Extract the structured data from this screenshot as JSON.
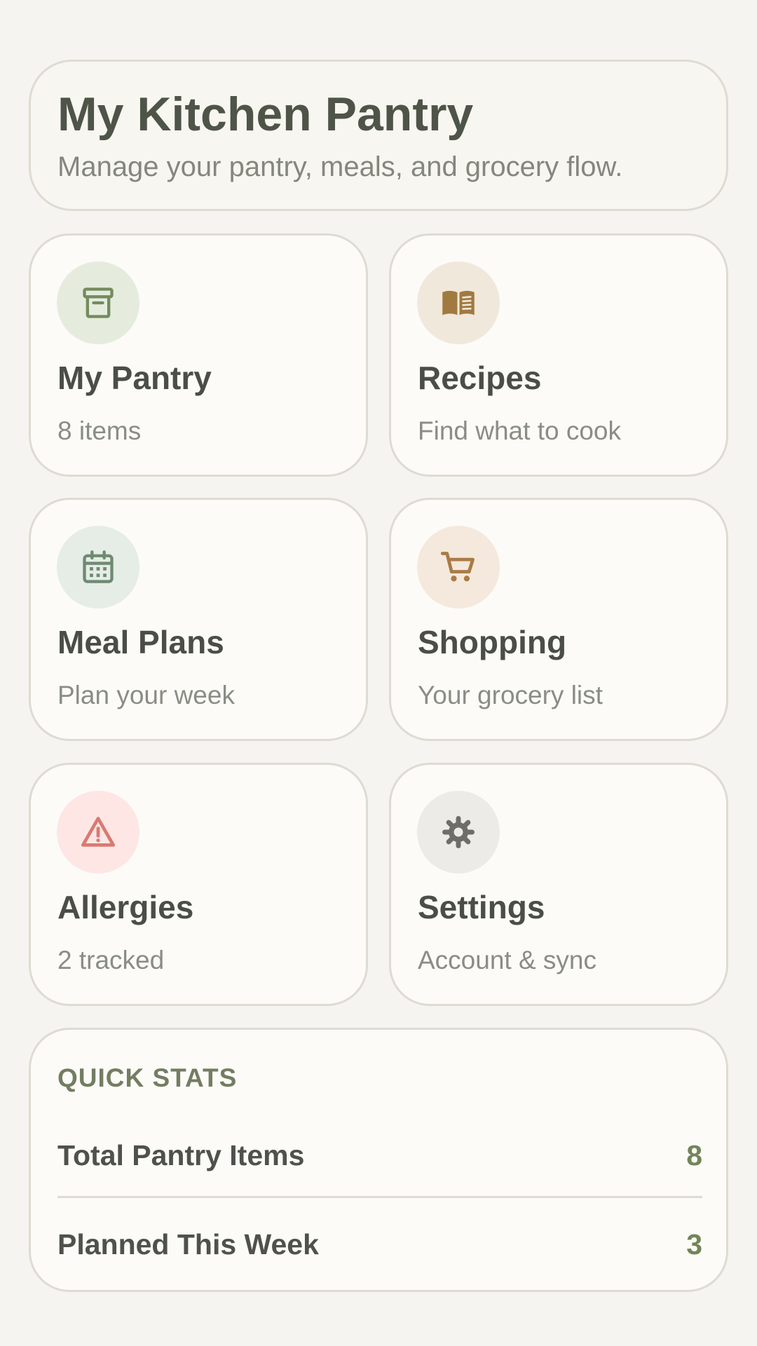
{
  "header": {
    "title": "My Kitchen Pantry",
    "subtitle": "Manage your pantry, meals, and grocery flow."
  },
  "cards": [
    {
      "title": "My Pantry",
      "subtitle": "8 items",
      "icon": "archive-box-icon",
      "icon_color": "#748b5e",
      "icon_bg": "#e5ecdd"
    },
    {
      "title": "Recipes",
      "subtitle": "Find what to cook",
      "icon": "open-book-icon",
      "icon_color": "#a17a3f",
      "icon_bg": "#f1e8dc"
    },
    {
      "title": "Meal Plans",
      "subtitle": "Plan your week",
      "icon": "calendar-icon",
      "icon_color": "#6f8a72",
      "icon_bg": "#e5ede6"
    },
    {
      "title": "Shopping",
      "subtitle": "Your grocery list",
      "icon": "shopping-cart-icon",
      "icon_color": "#a97b45",
      "icon_bg": "#f4e9dc"
    },
    {
      "title": "Allergies",
      "subtitle": "2 tracked",
      "icon": "warning-triangle-icon",
      "icon_color": "#d97a72",
      "icon_bg": "#fde6e4"
    },
    {
      "title": "Settings",
      "subtitle": "Account & sync",
      "icon": "gear-icon",
      "icon_color": "#6e6d69",
      "icon_bg": "#ecebe7"
    }
  ],
  "stats": {
    "heading": "QUICK STATS",
    "rows": [
      {
        "label": "Total Pantry Items",
        "value": "8"
      },
      {
        "label": "Planned This Week",
        "value": "3"
      }
    ]
  }
}
